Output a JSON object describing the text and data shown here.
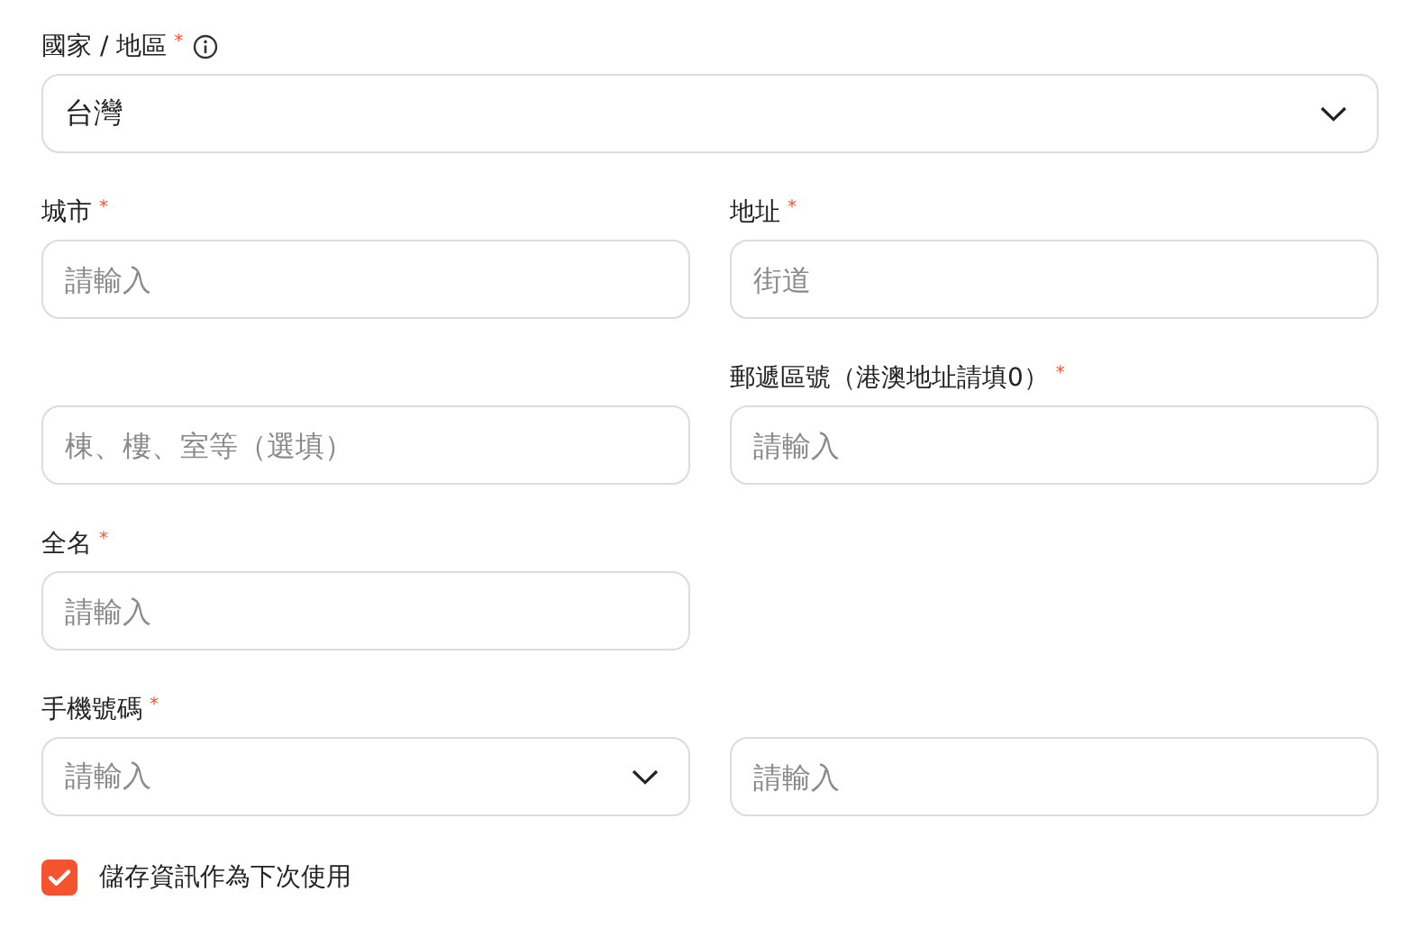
{
  "country": {
    "label": "國家 / 地區",
    "required_mark": "*",
    "info": true,
    "kind": "select",
    "value": "台灣"
  },
  "rows": [
    [
      {
        "label": "城市",
        "required_mark": "*",
        "kind": "input",
        "placeholder": "請輸入"
      },
      {
        "label": "地址",
        "required_mark": "*",
        "kind": "input",
        "placeholder": "街道"
      }
    ],
    [
      {
        "kind": "input",
        "placeholder": "棟、樓、室等（選填）"
      },
      {
        "label": "郵遞區號（港澳地址請填0）",
        "required_mark": "*",
        "kind": "input",
        "placeholder": "請輸入"
      }
    ],
    [
      {
        "label": "全名",
        "required_mark": "*",
        "kind": "input",
        "placeholder": "請輸入"
      }
    ],
    [
      {
        "label": "手機號碼",
        "required_mark": "*",
        "kind": "select",
        "placeholder": "請輸入"
      },
      {
        "kind": "input",
        "placeholder": "請輸入"
      }
    ]
  ],
  "save_info": {
    "label": "儲存資訊作為下次使用",
    "checked": true
  }
}
